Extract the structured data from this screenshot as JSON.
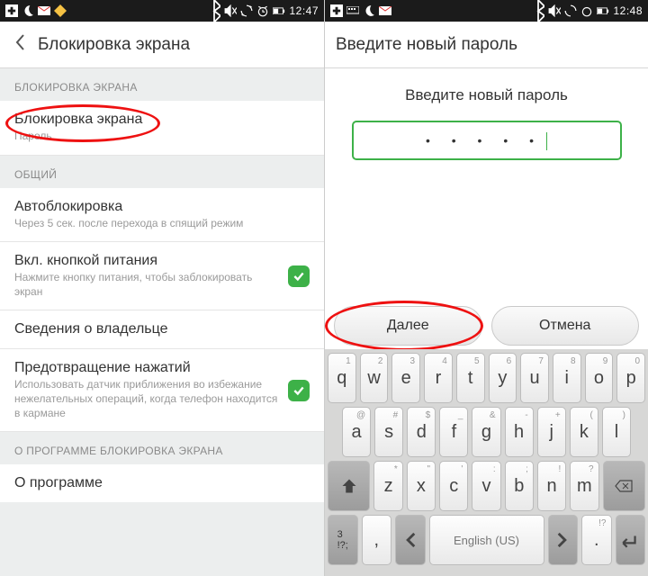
{
  "left": {
    "statusbar": {
      "time": "12:47"
    },
    "header": {
      "title": "Блокировка экрана"
    },
    "section1": {
      "label": "БЛОКИРОВКА ЭКРАНА"
    },
    "item_lock": {
      "title": "Блокировка экрана",
      "sub": "Пароль"
    },
    "section2": {
      "label": "ОБЩИЙ"
    },
    "item_auto": {
      "title": "Автоблокировка",
      "sub": "Через 5 сек. после перехода в спящий режим"
    },
    "item_power": {
      "title": "Вкл. кнопкой питания",
      "sub": "Нажмите кнопку питания, чтобы заблокировать экран"
    },
    "item_owner": {
      "title": "Сведения о владельце"
    },
    "item_prevent": {
      "title": "Предотвращение нажатий",
      "sub": "Использовать датчик приближения во избежание нежелательных операций, когда телефон находится в кармане"
    },
    "section3": {
      "label": "О ПРОГРАММЕ БЛОКИРОВКА ЭКРАНА"
    },
    "item_about": {
      "title": "О программе"
    }
  },
  "right": {
    "statusbar": {
      "time": "12:48"
    },
    "header": {
      "title": "Введите новый пароль"
    },
    "prompt": "Введите новый пароль",
    "password_mask": "•  •  •  •  •",
    "btn_next": "Далее",
    "btn_cancel": "Отмена",
    "keyboard": {
      "row1": [
        {
          "main": "q",
          "hint": "1"
        },
        {
          "main": "w",
          "hint": "2"
        },
        {
          "main": "e",
          "hint": "3"
        },
        {
          "main": "r",
          "hint": "4"
        },
        {
          "main": "t",
          "hint": "5"
        },
        {
          "main": "y",
          "hint": "6"
        },
        {
          "main": "u",
          "hint": "7"
        },
        {
          "main": "i",
          "hint": "8"
        },
        {
          "main": "o",
          "hint": "9"
        },
        {
          "main": "p",
          "hint": "0"
        }
      ],
      "row2": [
        {
          "main": "a",
          "hint": "@"
        },
        {
          "main": "s",
          "hint": "#"
        },
        {
          "main": "d",
          "hint": "$"
        },
        {
          "main": "f",
          "hint": "_"
        },
        {
          "main": "g",
          "hint": "&"
        },
        {
          "main": "h",
          "hint": "-"
        },
        {
          "main": "j",
          "hint": "+"
        },
        {
          "main": "k",
          "hint": "("
        },
        {
          "main": "l",
          "hint": ")"
        }
      ],
      "row3": [
        {
          "main": "z",
          "hint": "*"
        },
        {
          "main": "x",
          "hint": "\""
        },
        {
          "main": "c",
          "hint": "'"
        },
        {
          "main": "v",
          "hint": ":"
        },
        {
          "main": "b",
          "hint": ";"
        },
        {
          "main": "n",
          "hint": "!"
        },
        {
          "main": "m",
          "hint": "?"
        }
      ],
      "sym_key": "3\n!?;",
      "comma": ",",
      "space": "English (US)",
      "period": ".",
      "qmark": "!?"
    }
  }
}
